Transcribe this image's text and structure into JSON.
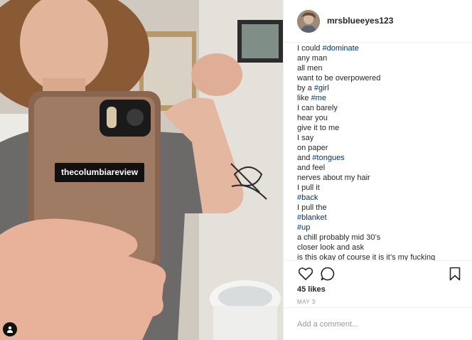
{
  "post": {
    "overlay_text": "thecolumbiareview"
  },
  "header": {
    "username": "mrsblueeyes123"
  },
  "caption": {
    "lines": [
      [
        {
          "text": "I could "
        },
        {
          "text": "#dominate",
          "hashtag": true
        }
      ],
      [
        {
          "text": "any man"
        }
      ],
      [
        {
          "text": "all men"
        }
      ],
      [
        {
          "text": "want to be overpowered"
        }
      ],
      [
        {
          "text": "by a "
        },
        {
          "text": "#girl",
          "hashtag": true
        }
      ],
      [
        {
          "text": "like "
        },
        {
          "text": "#me",
          "hashtag": true
        }
      ],
      [
        {
          "text": "I can barely"
        }
      ],
      [
        {
          "text": "hear you"
        }
      ],
      [
        {
          "text": "give it to me"
        }
      ],
      [
        {
          "text": "I say"
        }
      ],
      [
        {
          "text": "on paper"
        }
      ],
      [
        {
          "text": "and "
        },
        {
          "text": "#tongues",
          "hashtag": true
        }
      ],
      [
        {
          "text": "and feel"
        }
      ],
      [
        {
          "text": "nerves about my hair"
        }
      ],
      [
        {
          "text": "I pull it"
        }
      ],
      [
        {
          "text": "#back",
          "hashtag": true
        }
      ],
      [
        {
          "text": "I pull the"
        }
      ],
      [
        {
          "text": "#blanket",
          "hashtag": true
        }
      ],
      [
        {
          "text": "#up",
          "hashtag": true
        }
      ],
      [
        {
          "text": "a chill probably mid 30’s"
        }
      ],
      [
        {
          "text": "closer look and ask"
        }
      ],
      [
        {
          "text": "is this okay of course it is it’s my fucking"
        }
      ]
    ]
  },
  "actions": {
    "likes": "45 likes",
    "date": "MAY 3",
    "icons": [
      "heart-icon",
      "comment-icon",
      "bookmark-icon"
    ]
  },
  "comment": {
    "placeholder": "Add a comment..."
  },
  "colors": {
    "hashtag": "#003569",
    "text": "#262626",
    "muted": "#999999",
    "divider": "#efefef"
  }
}
